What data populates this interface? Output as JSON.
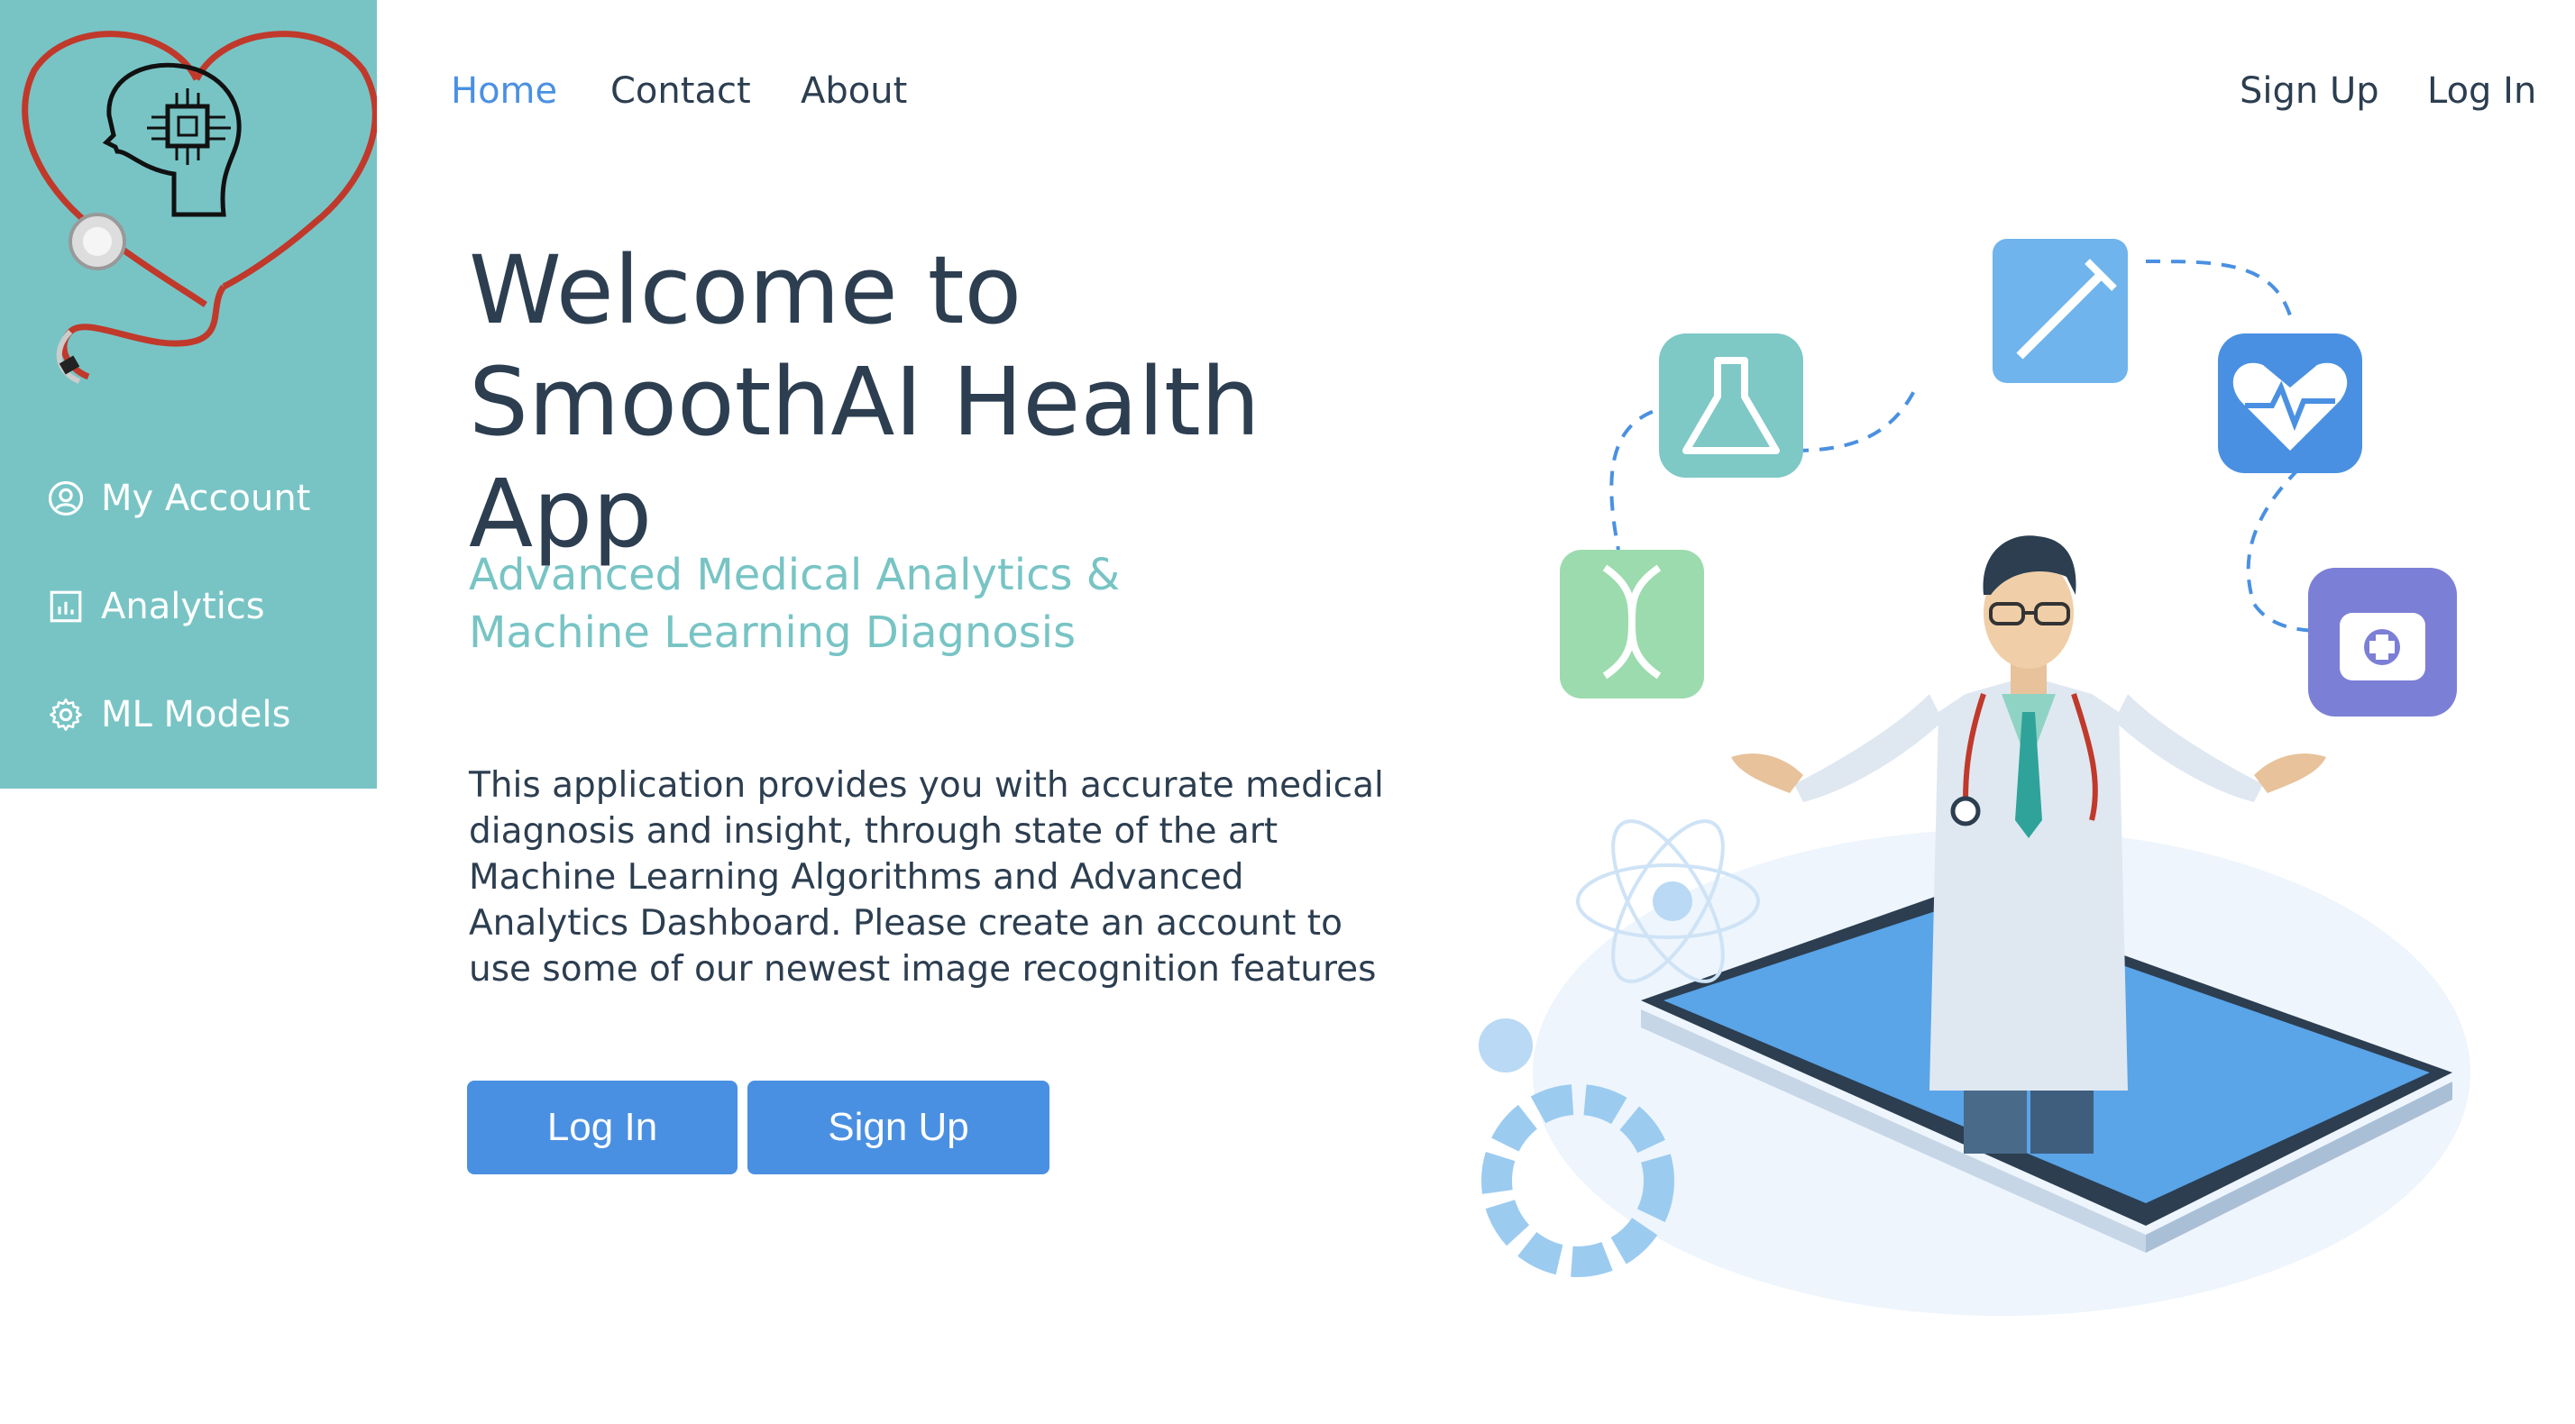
{
  "sidebar": {
    "logo_icon": "heart-stethoscope-brain-chip-logo",
    "items": [
      {
        "label": "My Account",
        "icon": "user-circle-icon"
      },
      {
        "label": "Analytics",
        "icon": "bar-chart-icon"
      },
      {
        "label": "ML Models",
        "icon": "gear-icon"
      }
    ]
  },
  "nav": {
    "home": "Home",
    "contact": "Contact",
    "about": "About",
    "sign_up": "Sign Up",
    "log_in": "Log In"
  },
  "hero": {
    "title_line1": "Welcome to",
    "title_line2": "SmoothAI Health App",
    "subtitle_line1": "Advanced Medical Analytics &",
    "subtitle_line2": "Machine Learning Diagnosis",
    "description": "This application provides you with accurate medical diagnosis and insight, through state of the art Machine Learning Algorithms and Advanced Analytics Dashboard. Please create an account to use some of our newest image recognition features",
    "login_button": "Log In",
    "signup_button": "Sign Up"
  },
  "colors": {
    "sidebar": "#78c4c5",
    "accent": "#4a90e2",
    "text": "#2c3e50",
    "subtitle": "#78c4c5"
  },
  "illustration": {
    "icons": [
      "flask-icon",
      "syringe-icon",
      "heart-pulse-icon",
      "dna-icon",
      "medical-kit-icon"
    ]
  }
}
